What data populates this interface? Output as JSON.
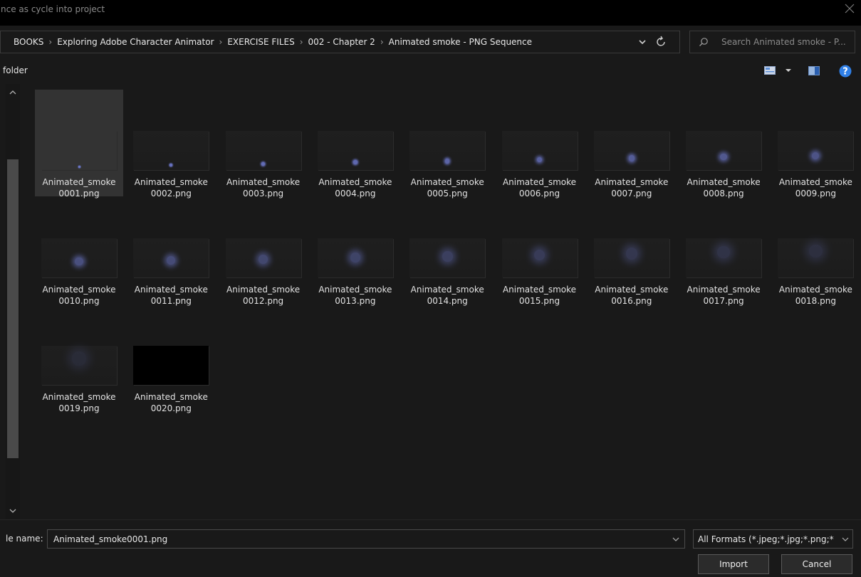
{
  "window": {
    "title": "nce as cycle into project"
  },
  "address": {
    "crumbs": [
      "BOOKS",
      "Exploring Adobe Character Animator",
      "EXERCISE FILES",
      "002 - Chapter 2",
      "Animated smoke - PNG Sequence"
    ],
    "separator": "›"
  },
  "search": {
    "placeholder": "Search Animated smoke - P..."
  },
  "toolbar": {
    "new_folder_label": "folder"
  },
  "files": [
    {
      "name_line1": "Animated_smoke",
      "name_line2": "0001.png",
      "selected": true
    },
    {
      "name_line1": "Animated_smoke",
      "name_line2": "0002.png"
    },
    {
      "name_line1": "Animated_smoke",
      "name_line2": "0003.png"
    },
    {
      "name_line1": "Animated_smoke",
      "name_line2": "0004.png"
    },
    {
      "name_line1": "Animated_smoke",
      "name_line2": "0005.png"
    },
    {
      "name_line1": "Animated_smoke",
      "name_line2": "0006.png"
    },
    {
      "name_line1": "Animated_smoke",
      "name_line2": "0007.png"
    },
    {
      "name_line1": "Animated_smoke",
      "name_line2": "0008.png"
    },
    {
      "name_line1": "Animated_smoke",
      "name_line2": "0009.png"
    },
    {
      "name_line1": "Animated_smoke",
      "name_line2": "0010.png"
    },
    {
      "name_line1": "Animated_smoke",
      "name_line2": "0011.png"
    },
    {
      "name_line1": "Animated_smoke",
      "name_line2": "0012.png"
    },
    {
      "name_line1": "Animated_smoke",
      "name_line2": "0013.png"
    },
    {
      "name_line1": "Animated_smoke",
      "name_line2": "0014.png"
    },
    {
      "name_line1": "Animated_smoke",
      "name_line2": "0015.png"
    },
    {
      "name_line1": "Animated_smoke",
      "name_line2": "0016.png"
    },
    {
      "name_line1": "Animated_smoke",
      "name_line2": "0017.png"
    },
    {
      "name_line1": "Animated_smoke",
      "name_line2": "0018.png"
    },
    {
      "name_line1": "Animated_smoke",
      "name_line2": "0019.png"
    },
    {
      "name_line1": "Animated_smoke",
      "name_line2": "0020.png"
    }
  ],
  "bottom": {
    "file_name_label": "le name:",
    "file_name_value": "Animated_smoke0001.png",
    "format_value": "All Formats (*.jpeg;*.jpg;*.png;*",
    "import_label": "Import",
    "cancel_label": "Cancel"
  },
  "colors": {
    "smoke_dot": "#6f7ad0",
    "help_icon": "#2f7fe6",
    "view_icon": "#5b8fd6"
  },
  "icons": {
    "close": "close-icon",
    "address_dropdown": "chevron-down-icon",
    "refresh": "refresh-icon",
    "search": "search-icon",
    "view_mode": "view-mode-icon",
    "preview_pane": "preview-pane-icon",
    "help": "help-icon"
  }
}
